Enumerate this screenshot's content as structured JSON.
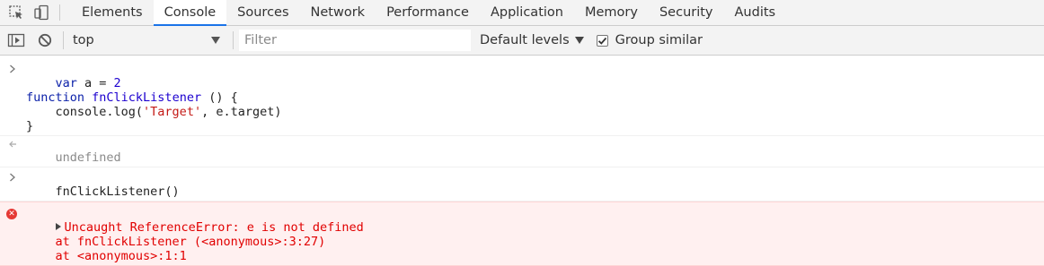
{
  "tabs": [
    "Elements",
    "Console",
    "Sources",
    "Network",
    "Performance",
    "Application",
    "Memory",
    "Security",
    "Audits"
  ],
  "selected_tab": "Console",
  "toolbar": {
    "context": "top",
    "filter_placeholder": "Filter",
    "levels_label": "Default levels",
    "group_similar_label": "Group similar",
    "group_similar_checked": true
  },
  "console": {
    "input1": {
      "line1_kw": "var",
      "line1_rest": " a = ",
      "line1_num": "2",
      "line2_kw": "function",
      "line2_name": " fnClickListener",
      "line2_rest": " () {",
      "line3_pre": "    console.log(",
      "line3_str": "'Target'",
      "line3_post": ", e.target)",
      "line4": "}"
    },
    "result1": "undefined",
    "input2": "fnClickListener()",
    "error": {
      "message": "Uncaught ReferenceError: e is not defined",
      "stack1": "    at fnClickListener (<anonymous>:3:27)",
      "stack2": "    at <anonymous>:1:1"
    }
  },
  "colors": {
    "accent": "#1a73e8",
    "error_text": "#e10000",
    "error_bg": "#fff0f0"
  }
}
